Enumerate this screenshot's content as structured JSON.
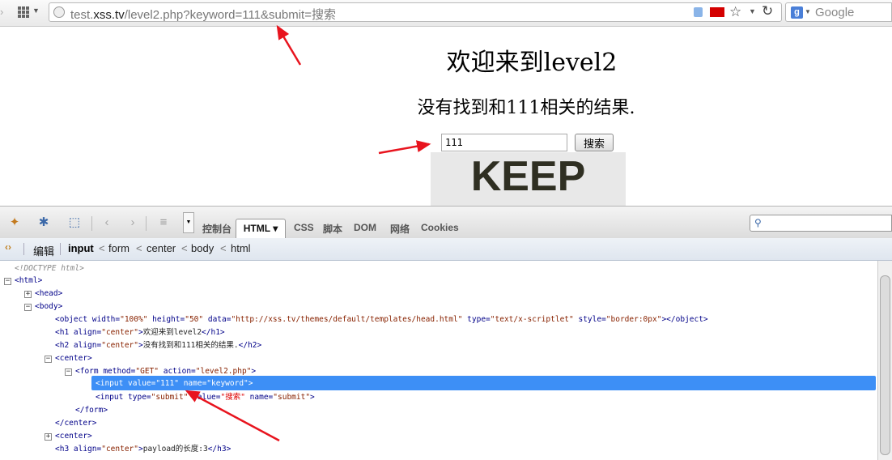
{
  "browser": {
    "url_host_prefix": "test.",
    "url_domain": "xss.tv",
    "url_path": "/level2.php?keyword=111&submit=搜索",
    "search_engine": "Google"
  },
  "page": {
    "title": "欢迎来到level2",
    "result": "没有找到和111相关的结果.",
    "keyword_value": "111",
    "submit_label": "搜索",
    "banner_text": "KEEP"
  },
  "firebug": {
    "tabs": [
      "控制台",
      "HTML ▾",
      "CSS",
      "脚本",
      "DOM",
      "网络",
      "Cookies"
    ],
    "edit_label": "编辑",
    "breadcrumb": [
      "input",
      "form",
      "center",
      "body",
      "html"
    ],
    "tree": {
      "doctype": "<!DOCTYPE html>",
      "html": "<html>",
      "head": "<head>",
      "body": "<body>",
      "object_tag": "<object",
      "object_width": "\"100%\"",
      "object_height": "\"50\"",
      "object_data": "\"http://xss.tv/themes/default/templates/head.html\"",
      "object_type": "\"text/x-scriptlet\"",
      "object_style": "\"border:0px\"",
      "h1_text": "欢迎来到level2",
      "h2_text": "没有找到和111相关的结果.",
      "form_method": "\"GET\"",
      "form_action": "\"level2.php\"",
      "input_value": "\"111\"",
      "input_name": "\"keyword\"",
      "input2_type": "\"submit\"",
      "input2_value": "\"搜索\"",
      "input2_name": "\"submit\"",
      "h3_text": "payload的长度:3"
    }
  },
  "colors": {
    "selection": "#3d8ff6",
    "annotation_arrows": "#e8141e"
  }
}
